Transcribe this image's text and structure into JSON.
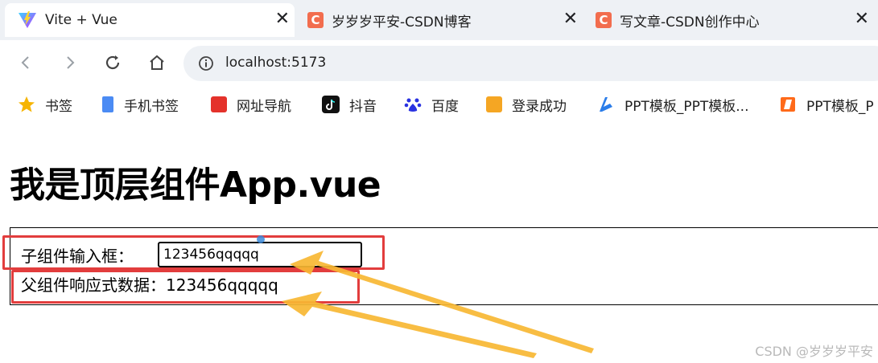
{
  "tabs": [
    {
      "title": "Vite + Vue",
      "icon": "vite-icon",
      "active": true
    },
    {
      "title": "岁岁岁平安-CSDN博客",
      "icon": "csdn-icon",
      "active": false
    },
    {
      "title": "写文章-CSDN创作中心",
      "icon": "csdn-icon",
      "active": false
    }
  ],
  "tab_close_glyph": "✕",
  "csdn_letter": "C",
  "toolbar": {
    "url": "localhost:5173"
  },
  "bookmarks": [
    {
      "label": "书签",
      "icon": "star-icon"
    },
    {
      "label": "手机书签",
      "icon": "phone-icon"
    },
    {
      "label": "网址导航",
      "icon": "nav-site-icon"
    },
    {
      "label": "抖音",
      "icon": "douyin-icon"
    },
    {
      "label": "百度",
      "icon": "baidu-icon"
    },
    {
      "label": "登录成功",
      "icon": "ep-icon"
    },
    {
      "label": "PPT模板_PPT模板...",
      "icon": "ppt-blue-icon"
    },
    {
      "label": "PPT模板_P",
      "icon": "ppt-orange-icon"
    }
  ],
  "page": {
    "heading": "我是顶层组件App.vue",
    "child_label": "子组件输入框：",
    "child_input_value": "123456qqqqq",
    "parent_label": "父组件响应式数据：",
    "parent_value": "123456qqqqq"
  },
  "watermark": "CSDN @岁岁岁平安",
  "colors": {
    "tabbar_bg": "#eef1f5",
    "highlight_red": "#e23d3d",
    "arrow_yellow": "#f7b733",
    "csdn_orange": "#f26d4e"
  }
}
